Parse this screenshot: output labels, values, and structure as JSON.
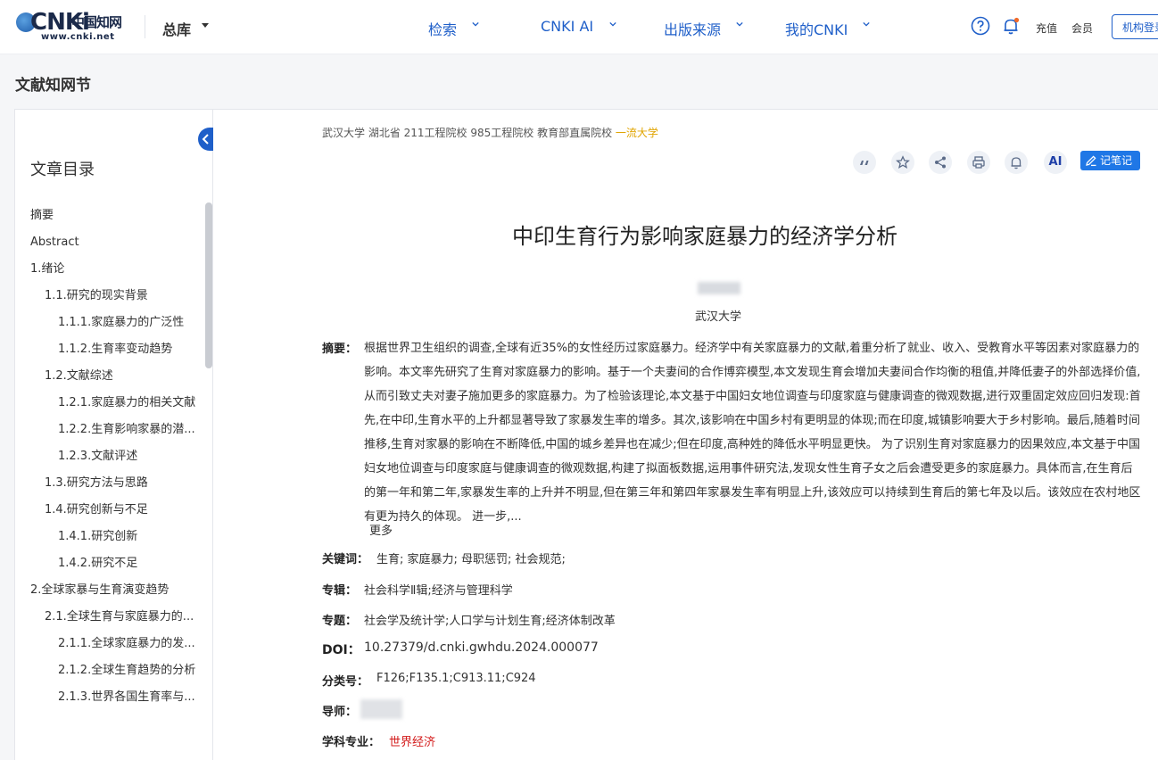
{
  "header": {
    "logo_mark": "CNKi",
    "logo_cn": "中国知网",
    "logo_url": "www.cnki.net",
    "library": "总库",
    "nav": [
      "检索",
      "CNKI AI",
      "出版来源",
      "我的CNKI"
    ],
    "recharge": "充值",
    "member": "会员",
    "org_login": "机构登录"
  },
  "section_title": "文献知网节",
  "toc": {
    "title": "文章目录",
    "items": [
      {
        "label": "摘要",
        "level": 0
      },
      {
        "label": "Abstract",
        "level": 0
      },
      {
        "label": "1.绪论",
        "level": 0
      },
      {
        "label": "1.1.研究的现实背景",
        "level": 1
      },
      {
        "label": "1.1.1.家庭暴力的广泛性",
        "level": 2
      },
      {
        "label": "1.1.2.生育率变动趋势",
        "level": 2
      },
      {
        "label": "1.2.文献综述",
        "level": 1
      },
      {
        "label": "1.2.1.家庭暴力的相关文献",
        "level": 2
      },
      {
        "label": "1.2.2.生育影响家暴的潜...",
        "level": 2
      },
      {
        "label": "1.2.3.文献评述",
        "level": 2
      },
      {
        "label": "1.3.研究方法与思路",
        "level": 1
      },
      {
        "label": "1.4.研究创新与不足",
        "level": 1
      },
      {
        "label": "1.4.1.研究创新",
        "level": 2
      },
      {
        "label": "1.4.2.研究不足",
        "level": 2
      },
      {
        "label": "2.全球家暴与生育演变趋势",
        "level": 0
      },
      {
        "label": "2.1.全球生育与家庭暴力的...",
        "level": 1
      },
      {
        "label": "2.1.1.全球家庭暴力的发...",
        "level": 2
      },
      {
        "label": "2.1.2.全球生育趋势的分析",
        "level": 2
      },
      {
        "label": "2.1.3.世界各国生育率与...",
        "level": 2
      }
    ]
  },
  "article": {
    "org_tags": "武汉大学  湖北省 211工程院校 985工程院校 教育部直属院校 ",
    "org_tag_gold": "一流大学",
    "note_label": "记笔记",
    "ai_label": "AI",
    "title": "中印生育行为影响家庭暴力的经济学分析",
    "affiliation": "武汉大学",
    "abstract_label": "摘要：",
    "abstract": "根据世界卫生组织的调查,全球有近35%的女性经历过家庭暴力。经济学中有关家庭暴力的文献,着重分析了就业、收入、受教育水平等因素对家庭暴力的影响。本文率先研究了生育对家庭暴力的影响。基于一个夫妻间的合作博弈模型,本文发现生育会增加夫妻间合作均衡的租值,并降低妻子的外部选择价值,从而引致丈夫对妻子施加更多的家庭暴力。为了检验该理论,本文基于中国妇女地位调查与印度家庭与健康调查的微观数据,进行双重固定效应回归发现:首先,在中印,生育水平的上升都显著导致了家暴发生率的增多。其次,该影响在中国乡村有更明显的体现;而在印度,城镇影响要大于乡村影响。最后,随着时间推移,生育对家暴的影响在不断降低,中国的城乡差异也在减少;但在印度,高种姓的降低水平明显更快。 为了识别生育对家庭暴力的因果效应,本文基于中国妇女地位调查与印度家庭与健康调查的微观数据,构建了拟面板数据,运用事件研究法,发现女性生育子女之后会遭受更多的家庭暴力。具体而言,在生育后的第一年和第二年,家暴发生率的上升并不明显,但在第三年和第四年家暴发生率有明显上升,该效应可以持续到生育后的第七年及以后。该效应在农村地区有更为持久的体现。 进一步,...",
    "more": "更多",
    "keywords_label": "关键词：",
    "keywords": "生育;  家庭暴力;  母职惩罚;  社会规范;",
    "series_label": "专辑：",
    "series": "社会科学Ⅱ辑;经济与管理科学",
    "topic_label": "专题：",
    "topic": "社会学及统计学;人口学与计划生育;经济体制改革",
    "doi_label": "DOI：",
    "doi": "10.27379/d.cnki.gwhdu.2024.000077",
    "class_label": "分类号：",
    "class": "F126;F135.1;C913.11;C924",
    "advisor_label": "导师：",
    "major_label": "学科专业：",
    "major": "世界经济"
  },
  "colors": {
    "brand": "#1f5fc9",
    "accent_red": "#d31a1a",
    "gold": "#e0a400"
  }
}
